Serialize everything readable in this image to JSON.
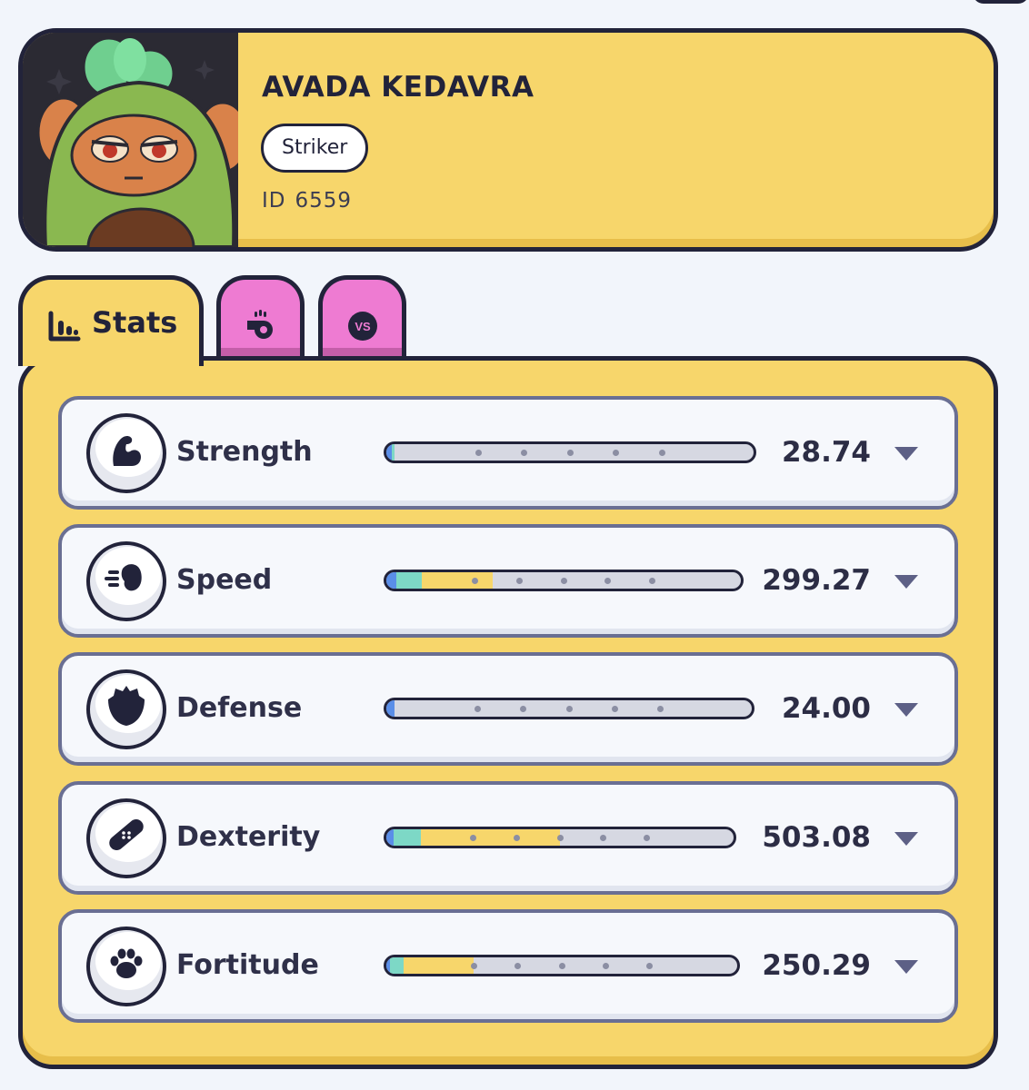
{
  "pet": {
    "name": "AVADA KEDAVRA",
    "role": "Striker",
    "id_label": "ID",
    "id_value": "6559",
    "avatar_icon": "avocado-pet-avatar"
  },
  "tabs": [
    {
      "label": "Stats",
      "icon": "bar-chart-icon",
      "active": true
    },
    {
      "label": "",
      "icon": "whistle-icon",
      "active": false
    },
    {
      "label": "",
      "icon": "versus-icon",
      "icon_text": "VS",
      "active": false
    }
  ],
  "colors": {
    "panel": "#f7d66b",
    "outline": "#22233a",
    "tab_pink": "#ee7bd2",
    "bar_blue": "#5a8ee8",
    "bar_teal": "#7dd8c6",
    "bar_yellow": "#f7d66b",
    "bar_track": "#d6d8e2"
  },
  "stats": [
    {
      "name": "Strength",
      "value": "28.74",
      "icon": "flexed-arm-icon",
      "bar": {
        "blue": 0.016,
        "teal": 0.006,
        "yellow": 0.0
      }
    },
    {
      "name": "Speed",
      "value": "299.27",
      "icon": "speeding-fist-icon",
      "bar": {
        "blue": 0.028,
        "teal": 0.072,
        "yellow": 0.2
      }
    },
    {
      "name": "Defense",
      "value": "24.00",
      "icon": "shield-icon",
      "bar": {
        "blue": 0.022,
        "teal": 0.0,
        "yellow": 0.0
      }
    },
    {
      "name": "Dexterity",
      "value": "503.08",
      "icon": "bandage-icon",
      "bar": {
        "blue": 0.022,
        "teal": 0.078,
        "yellow": 0.4
      }
    },
    {
      "name": "Fortitude",
      "value": "250.29",
      "icon": "paw-icon",
      "bar": {
        "blue": 0.01,
        "teal": 0.04,
        "yellow": 0.2
      }
    }
  ]
}
